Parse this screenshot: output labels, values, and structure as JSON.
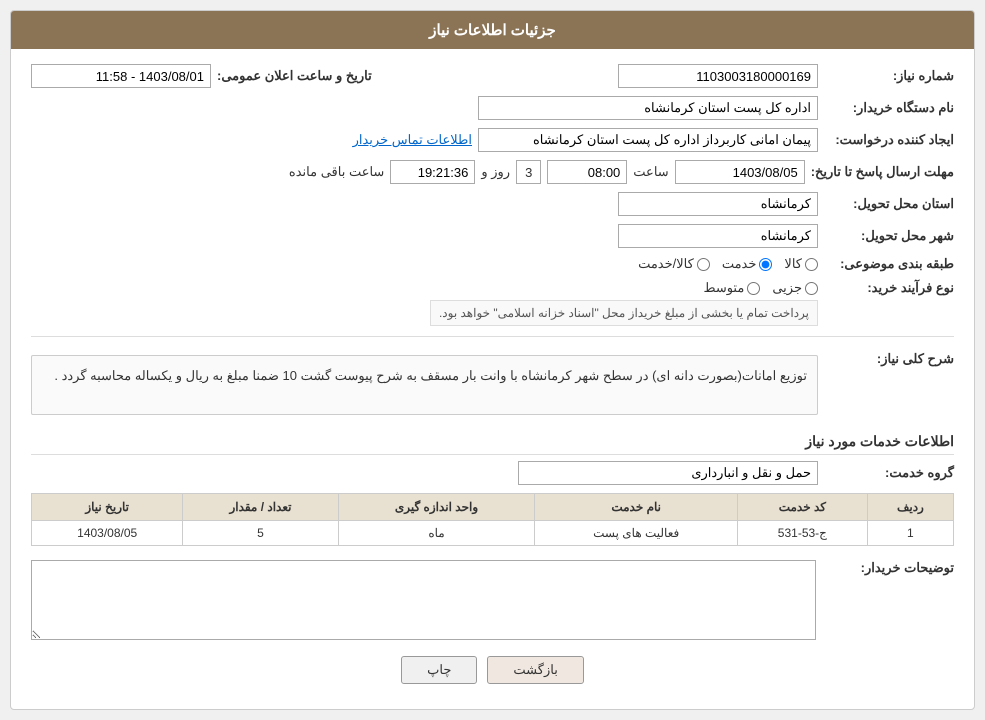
{
  "header": {
    "title": "جزئیات اطلاعات نیاز"
  },
  "fields": {
    "request_number_label": "شماره نیاز:",
    "request_number_value": "1103003180000169",
    "buyer_org_label": "نام دستگاه خریدار:",
    "buyer_org_value": "اداره کل پست استان کرمانشاه",
    "creator_label": "ایجاد کننده درخواست:",
    "creator_value": "پیمان امانی کاربرداز اداره کل پست استان کرمانشاه",
    "contact_link": "اطلاعات تماس خریدار",
    "deadline_label": "مهلت ارسال پاسخ تا تاریخ:",
    "deadline_date": "1403/08/05",
    "deadline_time_label": "ساعت",
    "deadline_time_value": "08:00",
    "deadline_days_label": "روز و",
    "deadline_days_value": "3",
    "deadline_remaining_label": "ساعت باقی مانده",
    "deadline_remaining_value": "19:21:36",
    "announce_label": "تاریخ و ساعت اعلان عمومی:",
    "announce_value": "1403/08/01 - 11:58",
    "province_label": "استان محل تحویل:",
    "province_value": "کرمانشاه",
    "city_label": "شهر محل تحویل:",
    "city_value": "کرمانشاه",
    "category_label": "طبقه بندی موضوعی:",
    "category_options": [
      {
        "label": "کالا",
        "name": "cat",
        "value": "kala"
      },
      {
        "label": "خدمت",
        "name": "cat",
        "value": "khedmat",
        "checked": true
      },
      {
        "label": "کالا/خدمت",
        "name": "cat",
        "value": "kala_khedmat"
      }
    ],
    "process_label": "نوع فرآیند خرید:",
    "process_options": [
      {
        "label": "جزیی",
        "name": "proc",
        "value": "jozii"
      },
      {
        "label": "متوسط",
        "name": "proc",
        "value": "motavaset"
      },
      {
        "label": "process_note",
        "value": ""
      }
    ],
    "process_note": "پرداخت تمام یا بخشی از مبلغ خریداز محل \"اسناد خزانه اسلامی\" خواهد بود.",
    "description_label": "شرح کلی نیاز:",
    "description_text": "توزیع امانات(بصورت دانه ای) در سطح شهر کرمانشاه با وانت بار مسقف به شرح پیوست گشت 10 ضمنا مبلغ به ریال و یکساله محاسبه گردد .",
    "services_section_title": "اطلاعات خدمات مورد نیاز",
    "service_group_label": "گروه خدمت:",
    "service_group_value": "حمل و نقل و انبارداری",
    "table": {
      "columns": [
        {
          "label": "ردیف"
        },
        {
          "label": "کد خدمت"
        },
        {
          "label": "نام خدمت"
        },
        {
          "label": "واحد اندازه گیری"
        },
        {
          "label": "تعداد / مقدار"
        },
        {
          "label": "تاریخ نیاز"
        }
      ],
      "rows": [
        {
          "row": "1",
          "code": "ج-53-531",
          "name": "فعالیت های پست",
          "unit": "ماه",
          "quantity": "5",
          "date": "1403/08/05"
        }
      ]
    },
    "buyer_notes_label": "توضیحات خریدار:",
    "buyer_notes_value": ""
  },
  "buttons": {
    "back_label": "بازگشت",
    "print_label": "چاپ"
  }
}
